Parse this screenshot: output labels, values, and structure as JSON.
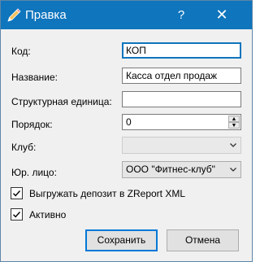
{
  "window": {
    "title": "Правка",
    "help_label": "?",
    "close_label": "✕"
  },
  "form": {
    "code": {
      "label": "Код:",
      "value": "КОП"
    },
    "name": {
      "label": "Название:",
      "value": "Касса отдел продаж"
    },
    "unit": {
      "label": "Структурная единица:",
      "value": ""
    },
    "order": {
      "label": "Порядок:",
      "value": "0"
    },
    "club": {
      "label": "Клуб:",
      "value": ""
    },
    "legal": {
      "label": "Юр. лицо:",
      "value": "ООО \"Фитнес-клуб\""
    }
  },
  "checks": {
    "export": {
      "label": "Выгружать депозит в ZReport XML",
      "checked": true
    },
    "active": {
      "label": "Активно",
      "checked": true
    }
  },
  "buttons": {
    "save": "Сохранить",
    "cancel": "Отмена"
  },
  "colors": {
    "titlebar": "#0f75bd",
    "focus_accent": "#0078d7"
  },
  "icons": {
    "title": "pencil-icon",
    "spin_up": "spin-up-arrow-icon",
    "spin_down": "spin-down-arrow-icon",
    "dropdown": "chevron-down-icon",
    "check": "checkmark-icon"
  }
}
